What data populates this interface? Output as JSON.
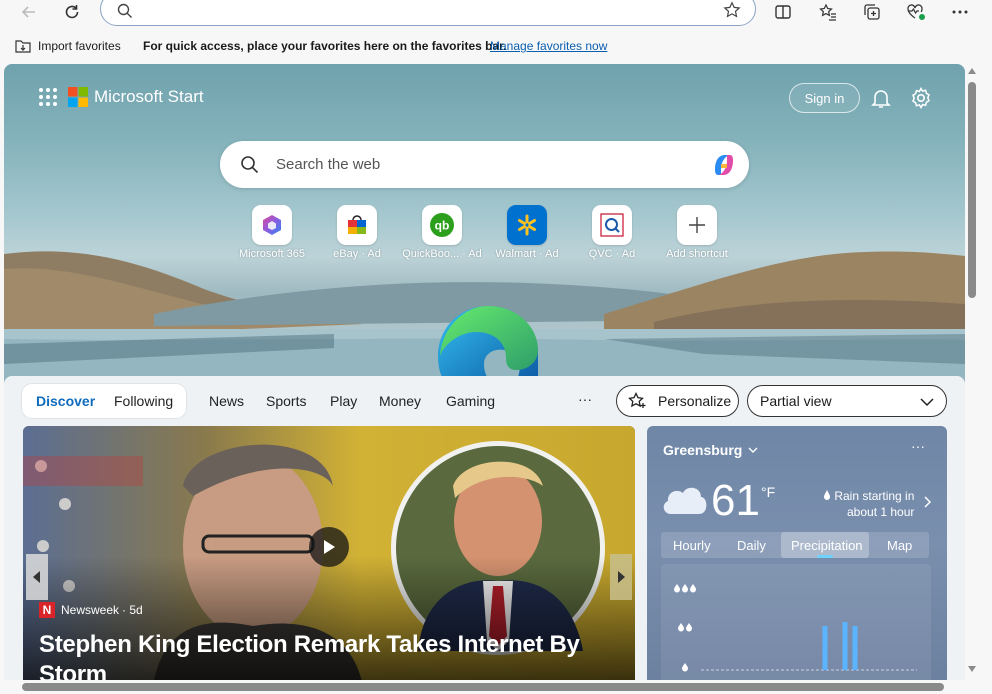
{
  "browser": {
    "address_value": "",
    "favorites_bar": {
      "import_label": "Import favorites",
      "message": "For quick access, place your favorites here on the favorites bar.",
      "link": "Manage favorites now"
    }
  },
  "header": {
    "brand": "Microsoft Start",
    "signin": "Sign in"
  },
  "search": {
    "placeholder": "Search the web"
  },
  "shortcuts": [
    {
      "label": "Microsoft 365"
    },
    {
      "label": "eBay · Ad"
    },
    {
      "label": "QuickBoo... · Ad"
    },
    {
      "label": "Walmart · Ad"
    },
    {
      "label": "QVC · Ad"
    },
    {
      "label": "Add shortcut"
    }
  ],
  "feed_tabs": {
    "discover": "Discover",
    "following": "Following",
    "items": [
      "News",
      "Sports",
      "Play",
      "Money",
      "Gaming"
    ],
    "more": "···",
    "personalize": "Personalize",
    "view": "Partial view"
  },
  "news_card": {
    "source": "Newsweek",
    "age": "· 5d",
    "headline": "Stephen King Election Remark Takes Internet By Storm"
  },
  "weather": {
    "location": "Greensburg",
    "temp": "61",
    "unit": "°F",
    "alert_line1": "Rain starting in",
    "alert_line2": "about 1 hour",
    "tabs": [
      "Hourly",
      "Daily",
      "Precipitation",
      "Map"
    ],
    "active_tab": "Precipitation",
    "precip_levels": [
      0,
      0,
      0,
      0,
      0,
      0,
      0,
      0,
      0,
      0,
      0,
      0,
      0.55,
      0,
      0.6,
      0.55,
      0,
      0,
      0,
      0,
      0,
      0
    ]
  },
  "colors": {
    "accent": "#0f6cbd",
    "link": "#0b5fb0"
  }
}
